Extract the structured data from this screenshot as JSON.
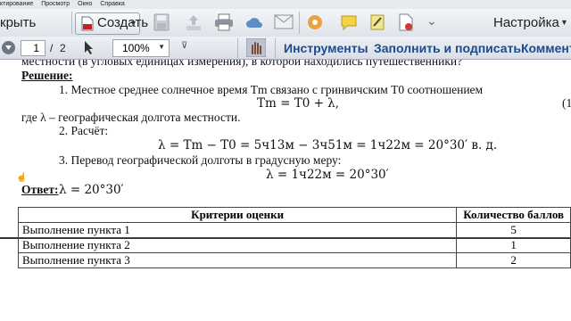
{
  "menubar": {
    "items": [
      "ктирование",
      "Просмотр",
      "Окно",
      "Справка"
    ]
  },
  "toolbar": {
    "open_label": "крыть",
    "create_label": "Создать",
    "customize_label": "Настройка",
    "page_current": "1",
    "page_sep": "/",
    "page_total": "2",
    "zoom_value": "100%",
    "tools_link": "Инструменты",
    "fill_sign_link": "Заполнить и подписать",
    "comment_link": "Коммент"
  },
  "document": {
    "line_top": "местности (в угловых единицах измерения), в которой находились путешественники?",
    "solution_heading": "Решение:",
    "step1": "1. Местное среднее солнечное время Tm связано с гринвичским T0 соотношением",
    "formula1": "Tm = T0 + λ,",
    "eq_num": "(1",
    "where_line": "где λ – географическая долгота местности.",
    "step2": "2. Расчёт:",
    "formula2": "λ = Tm − T0 = 5ч13м − 3ч51м = 1ч22м = 20°30′ в. д.",
    "step3": "3. Перевод географической долготы в градусную меру:",
    "formula3": "λ = 1ч22м = 20°30′",
    "answer_label": "Ответ:",
    "answer_value": "λ = 20°30′"
  },
  "criteria_table": {
    "headers": [
      "Критерии оценки",
      "Количество баллов"
    ],
    "rows": [
      [
        "Выполнение пункта 1",
        "5"
      ],
      [
        "Выполнение пункта 2",
        "1"
      ],
      [
        "Выполнение пункта 3",
        "2"
      ]
    ]
  },
  "colors": {
    "link": "#1d4a8c",
    "toolbar_bg": "#e3e7ec"
  }
}
